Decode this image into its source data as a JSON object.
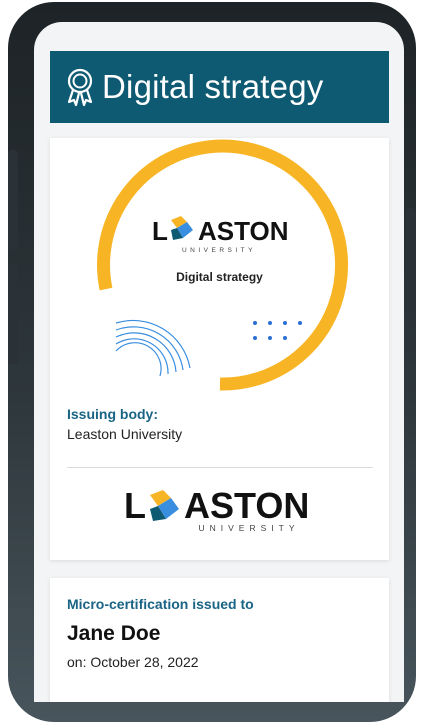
{
  "header": {
    "icon": "award-ribbon-icon",
    "title": "Digital strategy"
  },
  "badge": {
    "logo_word": "ASTON",
    "logo_initial": "L",
    "logo_sub": "UNIVERSITY",
    "title": "Digital strategy",
    "colors": {
      "ring": "#f7b424",
      "arcs": "#3a8ee0",
      "dots": "#2a6fd6"
    }
  },
  "issuer": {
    "label": "Issuing body:",
    "value": "Leaston University",
    "logo_initial": "L",
    "logo_word": "ASTON",
    "logo_sub": "UNIVERSITY"
  },
  "recipient": {
    "label": "Micro-certification issued to",
    "name": "Jane Doe",
    "date": "on: October 28, 2022"
  },
  "colors": {
    "header_bg": "#0f5a73",
    "accent_text": "#1a6486"
  }
}
